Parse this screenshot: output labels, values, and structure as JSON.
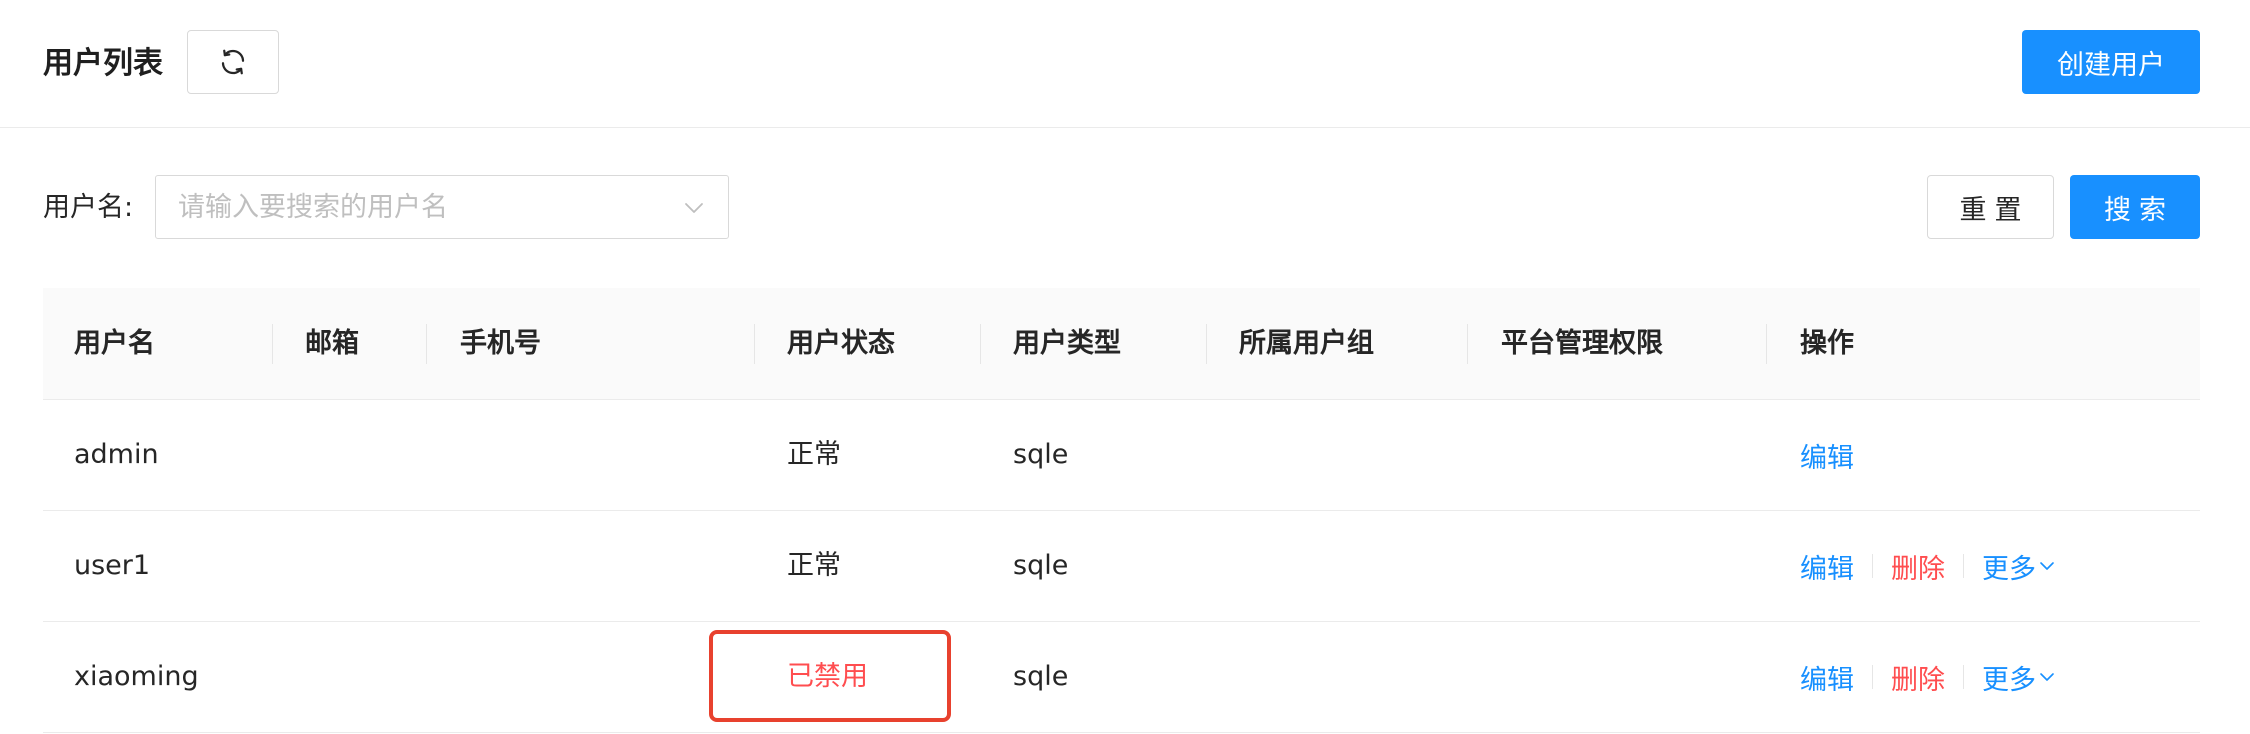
{
  "header": {
    "title": "用户列表",
    "create_button": "创建用户"
  },
  "filter": {
    "label": "用户名:",
    "placeholder": "请输入要搜索的用户名",
    "reset_button": "重置",
    "search_button": "搜索"
  },
  "table": {
    "columns": [
      "用户名",
      "邮箱",
      "手机号",
      "用户状态",
      "用户类型",
      "所属用户组",
      "平台管理权限",
      "操作"
    ],
    "rows": [
      {
        "username": "admin",
        "email": "",
        "phone": "",
        "status": "正常",
        "type": "sqle",
        "group": "",
        "permission": "",
        "actions": {
          "edit": "编辑"
        }
      },
      {
        "username": "user1",
        "email": "",
        "phone": "",
        "status": "正常",
        "type": "sqle",
        "group": "",
        "permission": "",
        "actions": {
          "edit": "编辑",
          "delete": "删除",
          "more": "更多"
        }
      },
      {
        "username": "xiaoming",
        "email": "",
        "phone": "",
        "status": "已禁用",
        "type": "sqle",
        "group": "",
        "permission": "",
        "actions": {
          "edit": "编辑",
          "delete": "删除",
          "more": "更多"
        }
      }
    ]
  },
  "icons": {
    "refresh": "refresh-icon",
    "select_arrow": "chevron-down-icon",
    "more_arrow": "chevron-down-icon"
  },
  "colors": {
    "primary": "#1890ff",
    "danger": "#ff4d4f",
    "annotation": "#e8412e"
  }
}
